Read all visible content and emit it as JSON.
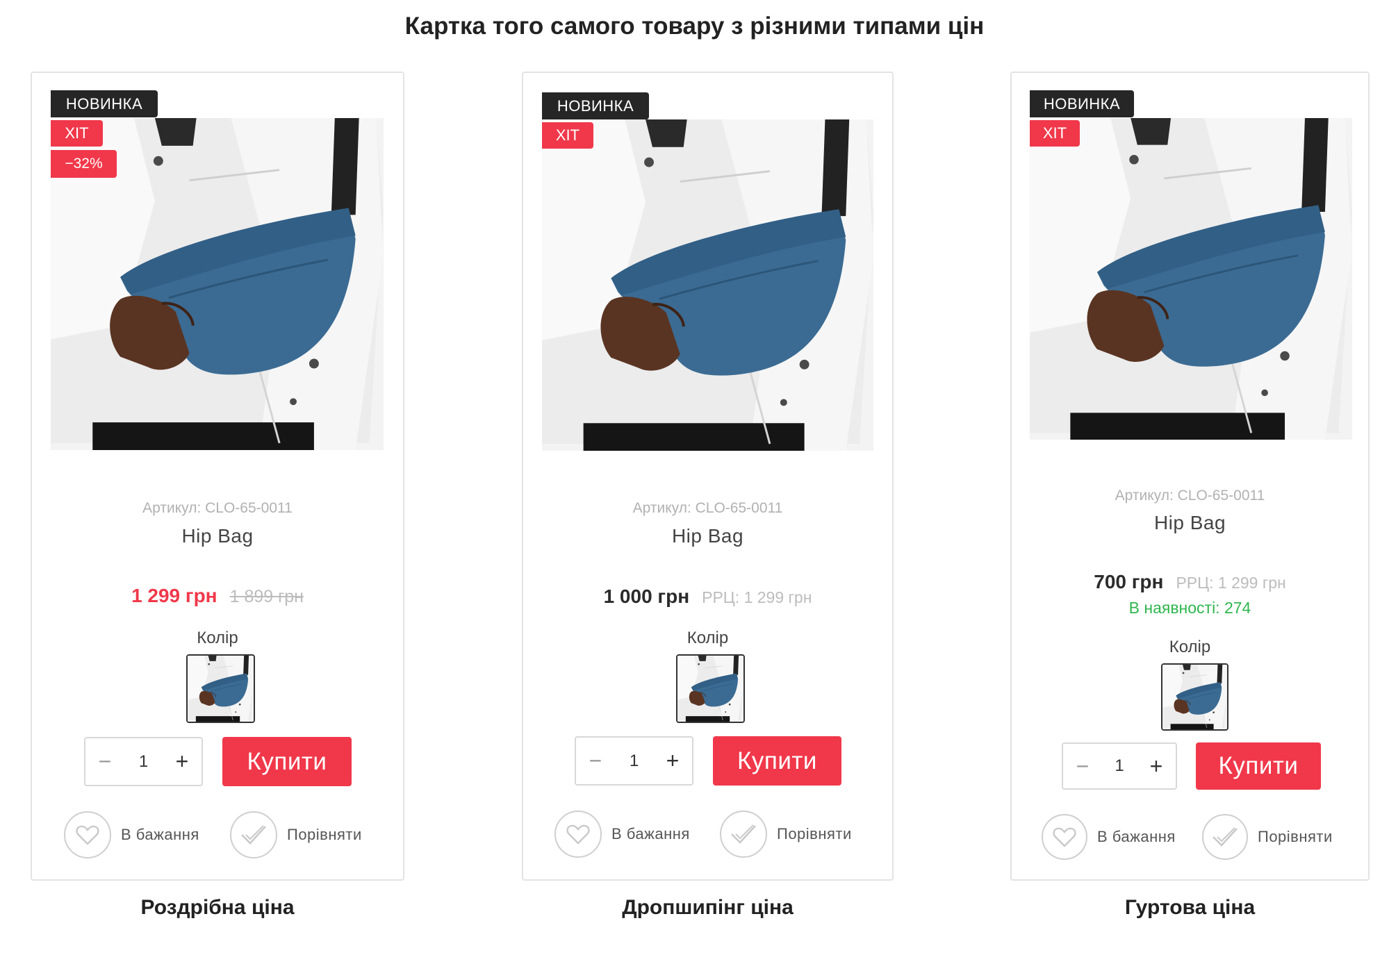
{
  "page": {
    "title": "Картка того самого товару з різними типами цін"
  },
  "colors": {
    "accent": "#f0384a",
    "badge_dark": "#262626",
    "stock_green": "#2fb64f",
    "muted": "#bcbcbc"
  },
  "cards": [
    {
      "badges": {
        "new": "НОВИНКА",
        "hit": "ХІТ",
        "sale": "−32%"
      },
      "sku": "Артикул: CLO-65-0011",
      "name": "Hip Bag",
      "price": "1 299 грн",
      "old_price": "1 899 грн",
      "color_label": "Колір",
      "qty_minus": "−",
      "qty": "1",
      "qty_plus": "+",
      "buy_label": "Купити",
      "wishlist_label": "В бажання",
      "compare_label": "Порівняти",
      "caption": "Роздрібна ціна"
    },
    {
      "badges": {
        "new": "НОВИНКА",
        "hit": "ХІТ"
      },
      "sku": "Артикул: CLO-65-0011",
      "name": "Hip Bag",
      "price": "1 000 грн",
      "rrp": "РРЦ: 1 299 грн",
      "color_label": "Колір",
      "qty_minus": "−",
      "qty": "1",
      "qty_plus": "+",
      "buy_label": "Купити",
      "wishlist_label": "В бажання",
      "compare_label": "Порівняти",
      "caption": "Дропшипінг ціна"
    },
    {
      "badges": {
        "new": "НОВИНКА",
        "hit": "ХІТ"
      },
      "sku": "Артикул: CLO-65-0011",
      "name": "Hip Bag",
      "price": "700 грн",
      "rrp": "РРЦ: 1 299 грн",
      "stock": "В наявності: 274",
      "color_label": "Колір",
      "qty_minus": "−",
      "qty": "1",
      "qty_plus": "+",
      "buy_label": "Купити",
      "wishlist_label": "В бажання",
      "compare_label": "Порівняти",
      "caption": "Гуртова ціна"
    }
  ],
  "icons": {
    "photo": "product-photo",
    "wishlist": "heart-icon",
    "compare": "check-icon"
  }
}
